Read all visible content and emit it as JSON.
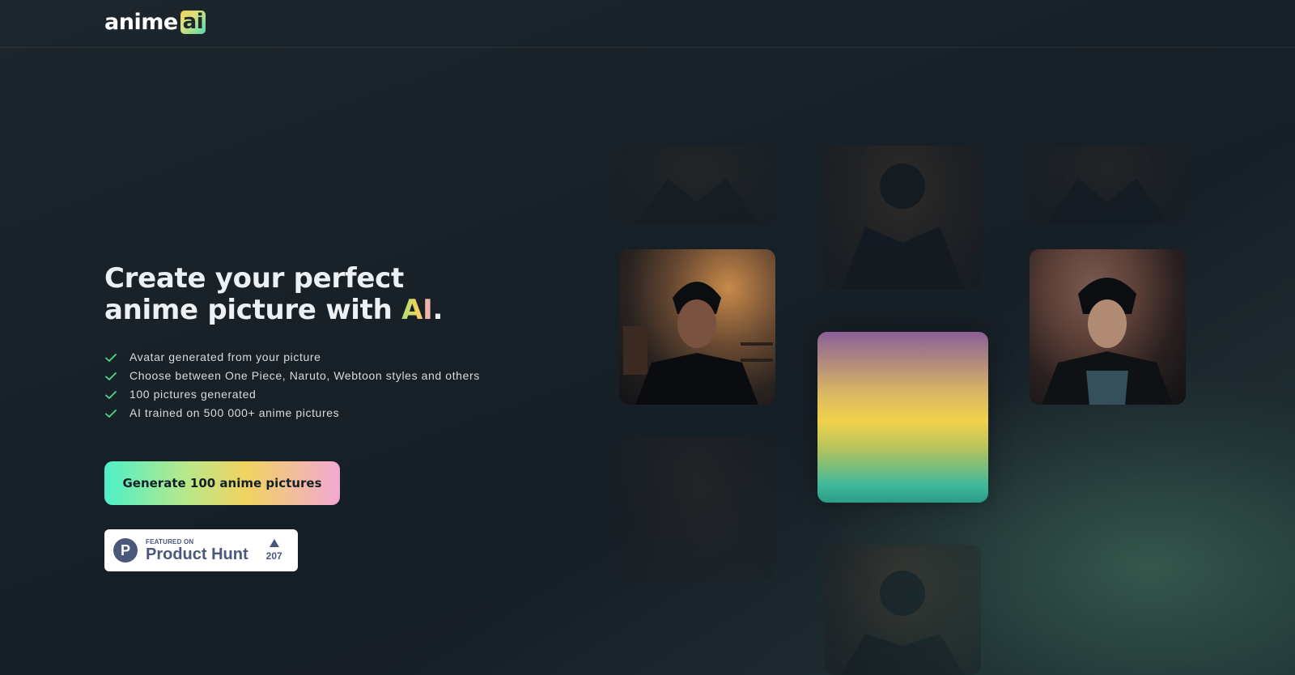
{
  "header": {
    "logo_text": "anime",
    "logo_badge": "ai"
  },
  "hero": {
    "title_line1": "Create your perfect",
    "title_line2_prefix": "anime picture with ",
    "title_accent": "AI",
    "title_suffix": "."
  },
  "features": [
    {
      "text": "Avatar generated from your picture",
      "icon": "check-icon"
    },
    {
      "text": "Choose between One Piece, Naruto, Webtoon styles and others",
      "icon": "check-icon"
    },
    {
      "text": "100 pictures generated",
      "icon": "check-icon"
    },
    {
      "text": "AI trained on 500 000+ anime pictures",
      "icon": "check-icon"
    }
  ],
  "cta": {
    "label": "Generate 100 anime pictures"
  },
  "product_hunt": {
    "featured_label": "FEATURED ON",
    "name": "Product Hunt",
    "logo_letter": "P",
    "votes": "207"
  },
  "colors": {
    "background": "#1a232a",
    "check": "#4ddc8a",
    "product_hunt": "#4b587c"
  }
}
